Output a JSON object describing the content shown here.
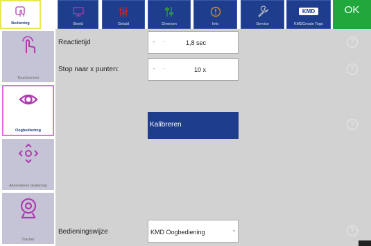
{
  "tabs": [
    {
      "label": "Bediening",
      "icon": "hand-pointer-icon",
      "active": true
    },
    {
      "label": "Beeld",
      "icon": "monitor-icon",
      "active": false
    },
    {
      "label": "Geluid",
      "icon": "sliders-icon",
      "active": false
    },
    {
      "label": "Diversen",
      "icon": "settings-sliders-icon",
      "active": false
    },
    {
      "label": "Info",
      "icon": "info-icon",
      "active": false
    },
    {
      "label": "Service",
      "icon": "wrench-icon",
      "active": false
    },
    {
      "label": "KMDCreate Togo",
      "logo_text": "KMD",
      "icon": "kmd-logo-icon",
      "active": false
    }
  ],
  "ok_label": "OK",
  "sidebar": [
    {
      "label": "Touchscreen",
      "icon": "touch-hand-icon",
      "active": false
    },
    {
      "label": "Oogbediening",
      "icon": "eye-icon",
      "active": true
    },
    {
      "label": "Alternatieve bediening",
      "icon": "direction-arrows-icon",
      "active": false
    },
    {
      "label": "Tracker",
      "icon": "webcam-icon",
      "active": false
    }
  ],
  "settings": {
    "reactietijd": {
      "label": "Reactietijd",
      "stepper": "+ −",
      "value": "1,8 sec"
    },
    "stop": {
      "label": "Stop naar x punten:",
      "stepper": "+ −",
      "value": "10 x"
    },
    "kalibreren_label": "Kalibreren",
    "bedieningswijze": {
      "label": "Bedieningswijze",
      "value": "KMD Oogbediening"
    }
  },
  "help_symbol": "?",
  "colors": {
    "tab_blue": "#1e3d8c",
    "ok_green": "#21a83c",
    "active_tab_border": "#e8e84a",
    "active_side_border": "#e46fe4",
    "icon_red": "#d02020",
    "icon_green": "#2f9a3a",
    "icon_orange": "#e08a1a",
    "icon_magenta": "#b03ab0"
  }
}
